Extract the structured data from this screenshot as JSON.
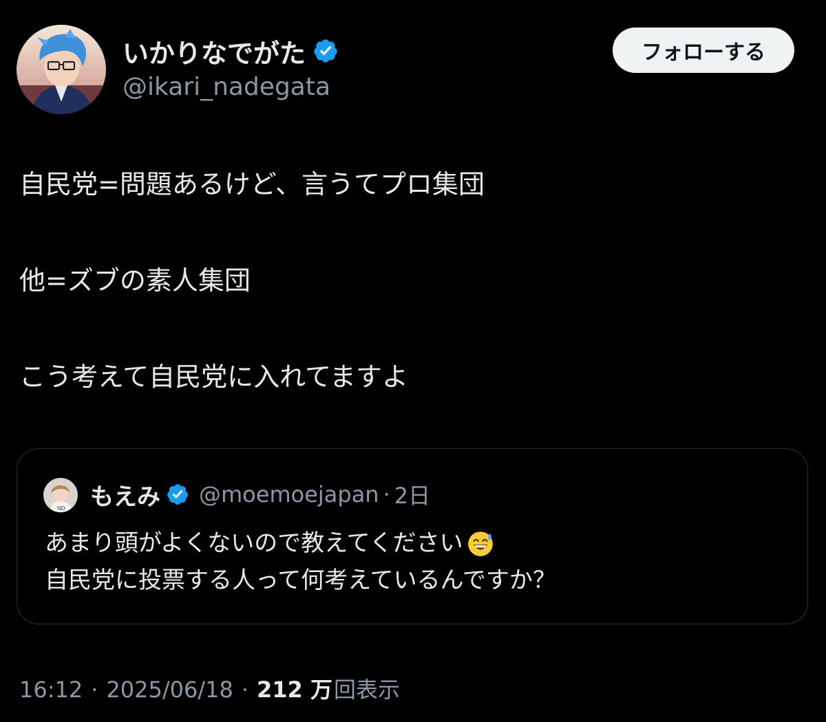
{
  "author": {
    "display_name": "いかりなでがた",
    "handle": "@ikari_nadegata",
    "verified_icon": "verified-badge-icon"
  },
  "follow_button": {
    "label": "フォローする"
  },
  "tweet": {
    "lines": [
      "自民党=問題あるけど、言うてプロ集団",
      "他=ズブの素人集団",
      "こう考えて自民党に入れてますよ"
    ]
  },
  "quoted": {
    "display_name": "もえみ",
    "handle": "@moemoejapan",
    "separator": "·",
    "time": "2日",
    "line1": "あまり頭がよくないので教えてください",
    "line1_emoji": "grinning-sweat-emoji",
    "line2": "自民党に投票する人って何考えているんですか？"
  },
  "meta": {
    "time": "16:12",
    "separator": "·",
    "date": "2025/06/18",
    "views_count": "212 万",
    "views_label": "回表示"
  },
  "colors": {
    "background": "#000000",
    "text": "#e7e9ea",
    "secondary_text": "#8b98a5",
    "verified_blue": "#1d9bf0",
    "follow_button_bg": "#eff3f4",
    "border": "#2f3336"
  }
}
